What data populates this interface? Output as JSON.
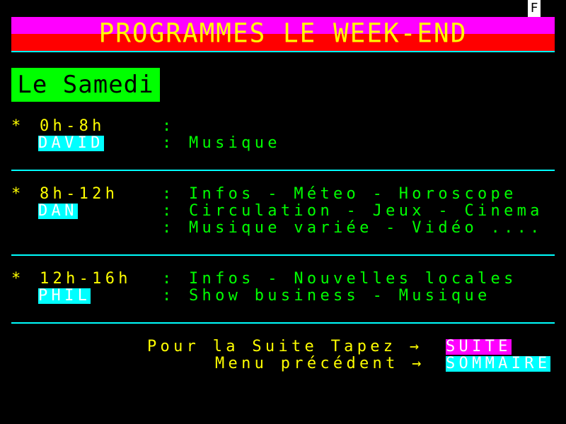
{
  "status": {
    "indicator": "F"
  },
  "header": {
    "title": "PROGRAMMES LE WEEK-END"
  },
  "day": {
    "label": "Le Samedi"
  },
  "schedule": [
    {
      "bullet": "*",
      "time": "0h-8h",
      "host": "DAVID",
      "lines": [
        "",
        "Musique"
      ]
    },
    {
      "bullet": "*",
      "time": "8h-12h",
      "host": "DAN",
      "lines": [
        "Infos - Méteo - Horoscope",
        "Circulation - Jeux - Cinema",
        "Musique variée - Vidéo ...."
      ]
    },
    {
      "bullet": "*",
      "time": "12h-16h",
      "host": "PHIL",
      "lines": [
        "Infos - Nouvelles locales",
        "Show business - Musique"
      ]
    }
  ],
  "separator": ":",
  "footer": {
    "next_text": "Pour la Suite Tapez →",
    "next_key": "SUITE",
    "prev_text": "Menu précédent →",
    "prev_key": "SOMMAIRE"
  },
  "colors": {
    "background": "#000000",
    "title_text": "#ffff00",
    "title_top_band": "#ff00ff",
    "title_bottom_band": "#ff0000",
    "day_box": "#00ff00",
    "time_text": "#ffff00",
    "program_text": "#00ff00",
    "divider": "#00ffff",
    "host_tag": "#00ffff",
    "suite_key": "#ff00ff",
    "sommaire_key": "#00ffff"
  }
}
